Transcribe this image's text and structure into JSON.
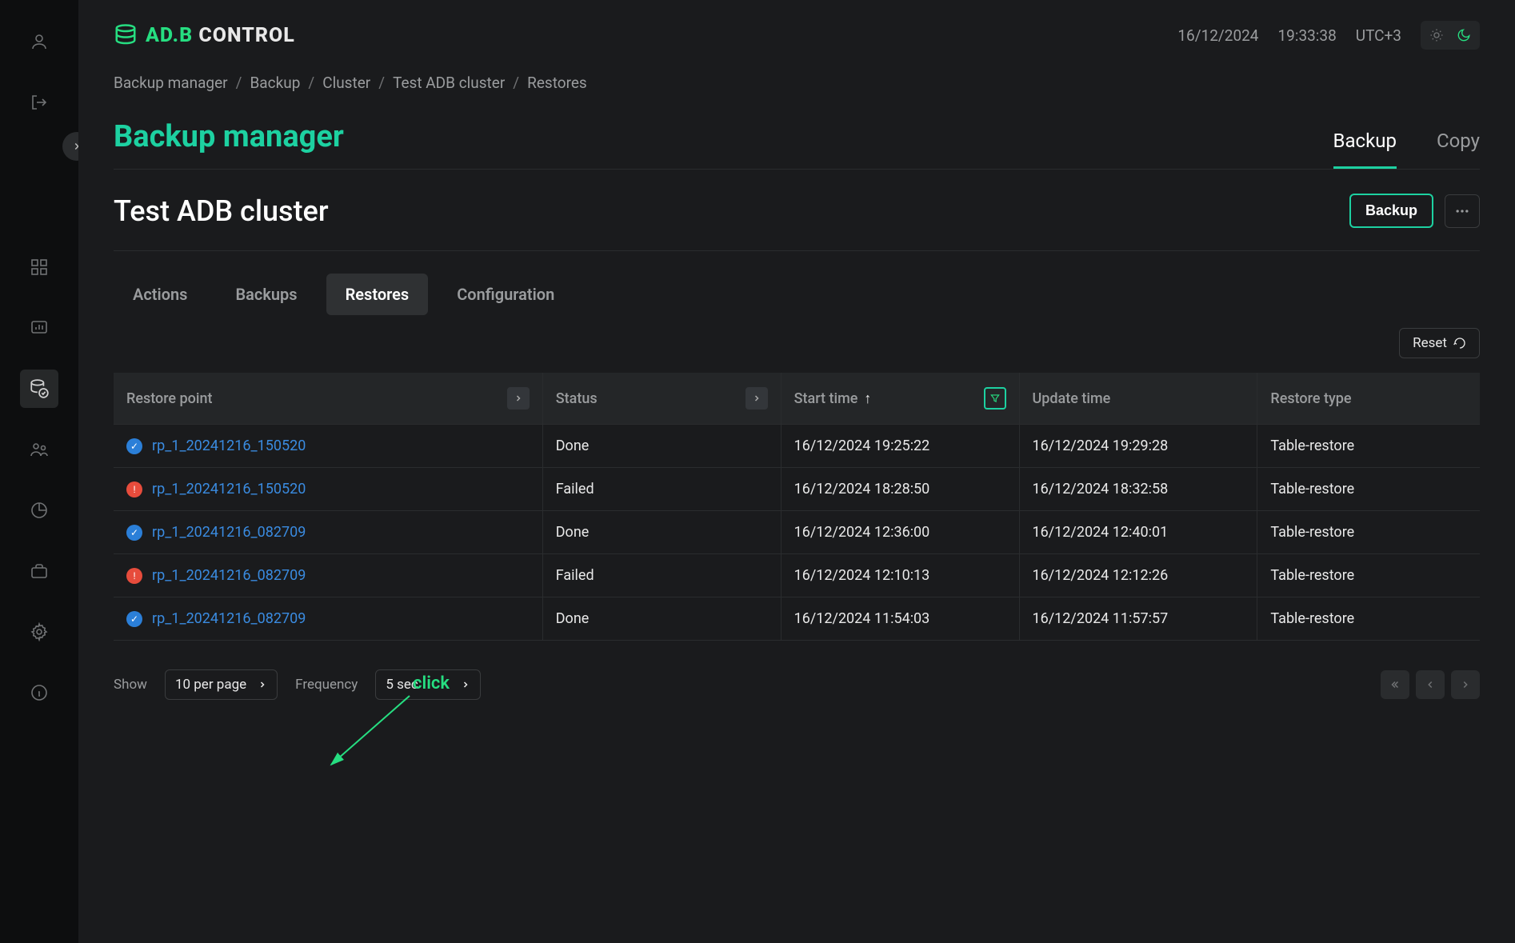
{
  "logo": {
    "brand_a": "AD.B",
    "brand_b": "CONTROL"
  },
  "header": {
    "date": "16/12/2024",
    "time": "19:33:38",
    "tz": "UTC+3"
  },
  "breadcrumb": [
    "Backup manager",
    "Backup",
    "Cluster",
    "Test ADB cluster",
    "Restores"
  ],
  "page_title": "Backup manager",
  "page_tabs": [
    {
      "label": "Backup",
      "active": true
    },
    {
      "label": "Copy",
      "active": false
    }
  ],
  "cluster_title": "Test ADB cluster",
  "backup_btn": "Backup",
  "subtabs": [
    {
      "label": "Actions",
      "active": false
    },
    {
      "label": "Backups",
      "active": false
    },
    {
      "label": "Restores",
      "active": true
    },
    {
      "label": "Configuration",
      "active": false
    }
  ],
  "reset_btn": "Reset",
  "annotation": "click",
  "table": {
    "columns": [
      "Restore point",
      "Status",
      "Start time",
      "Update time",
      "Restore type"
    ],
    "sort_col": 2,
    "sort_dir": "asc",
    "rows": [
      {
        "status": "ok",
        "restore_point": "rp_1_20241216_150520",
        "status_text": "Done",
        "start": "16/12/2024 19:25:22",
        "update": "16/12/2024 19:29:28",
        "type": "Table-restore"
      },
      {
        "status": "fail",
        "restore_point": "rp_1_20241216_150520",
        "status_text": "Failed",
        "start": "16/12/2024 18:28:50",
        "update": "16/12/2024 18:32:58",
        "type": "Table-restore"
      },
      {
        "status": "ok",
        "restore_point": "rp_1_20241216_082709",
        "status_text": "Done",
        "start": "16/12/2024 12:36:00",
        "update": "16/12/2024 12:40:01",
        "type": "Table-restore"
      },
      {
        "status": "fail",
        "restore_point": "rp_1_20241216_082709",
        "status_text": "Failed",
        "start": "16/12/2024 12:10:13",
        "update": "16/12/2024 12:12:26",
        "type": "Table-restore"
      },
      {
        "status": "ok",
        "restore_point": "rp_1_20241216_082709",
        "status_text": "Done",
        "start": "16/12/2024 11:54:03",
        "update": "16/12/2024 11:57:57",
        "type": "Table-restore"
      }
    ]
  },
  "pager": {
    "show_label": "Show",
    "show_value": "10 per page",
    "freq_label": "Frequency",
    "freq_value": "5 sec"
  },
  "colors": {
    "accent": "#1dd1a1",
    "link": "#3a8be0",
    "error": "#e74c3c",
    "success": "#2b7fd8"
  }
}
